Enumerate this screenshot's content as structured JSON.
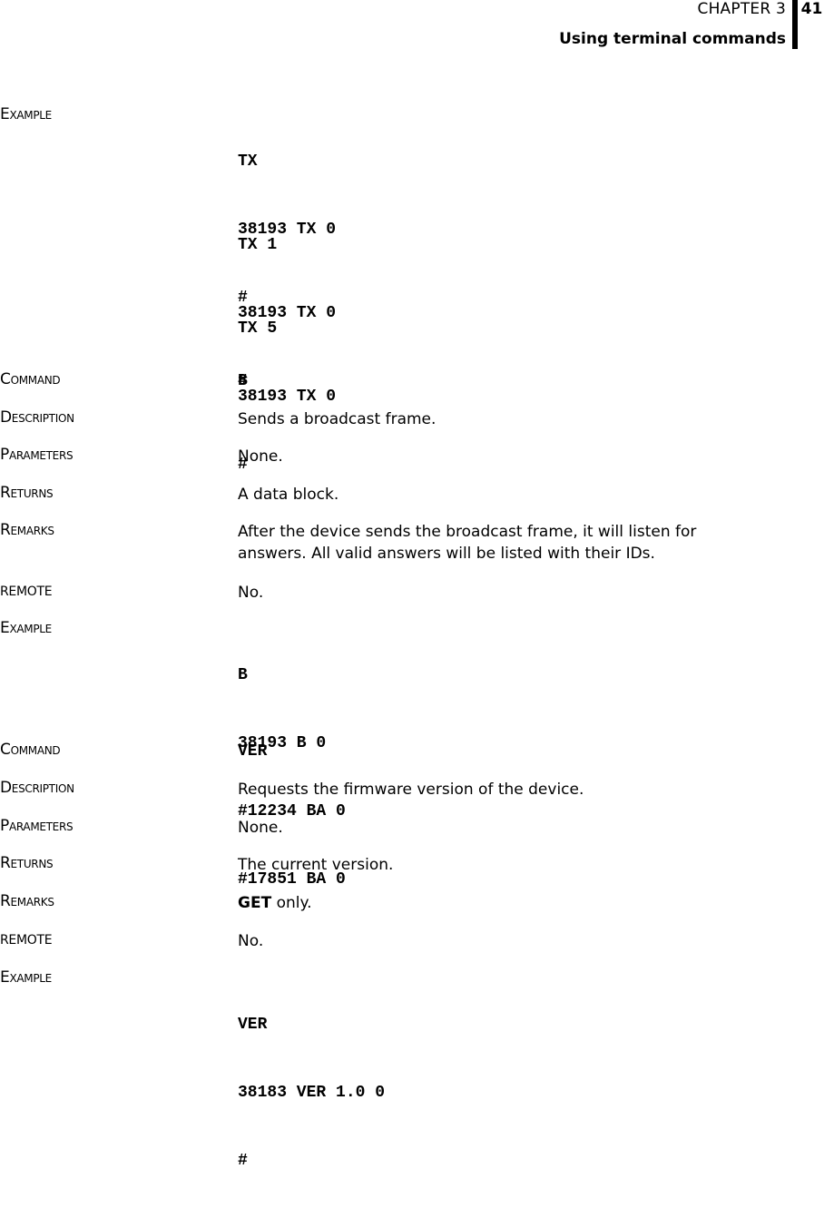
{
  "header": {
    "chapter": "CHAPTER 3",
    "section": "Using terminal commands",
    "page_number": "41"
  },
  "tx_example": {
    "label": "Example",
    "blocks": [
      [
        "TX",
        "38193 TX 0",
        "#"
      ],
      [
        "TX 1",
        "38193 TX 0",
        "#"
      ],
      [
        "TX 5",
        "38193 TX 0",
        "#"
      ]
    ]
  },
  "cmd_b": {
    "command_label": "Command",
    "command": "B",
    "description_label": "Description",
    "description": "Sends a broadcast frame.",
    "parameters_label": "Parameters",
    "parameters": "None.",
    "returns_label": "Returns",
    "returns": "A data block.",
    "remarks_label": "Remarks",
    "remarks_line1": "After the device sends the broadcast frame, it will listen for",
    "remarks_line2": "answers. All valid answers will be listed with their IDs.",
    "remote_label": "REMOTE",
    "remote": "No.",
    "example_label": "Example",
    "example_lines": [
      "B",
      "38193 B 0",
      "#12234 BA 0",
      "#17851 BA 0"
    ]
  },
  "cmd_ver": {
    "command_label": "Command",
    "command": "VER",
    "description_label": "Description",
    "description": "Requests the firmware version of the device.",
    "parameters_label": "Parameters",
    "parameters": "None.",
    "returns_label": "Returns",
    "returns": "The current version.",
    "remarks_label": "Remarks",
    "remarks_bold": "GET",
    "remarks_rest": " only.",
    "remote_label": "REMOTE",
    "remote": "No.",
    "example_label": "Example",
    "example_lines": [
      "VER",
      "38183 VER 1.0 0",
      "#"
    ]
  }
}
